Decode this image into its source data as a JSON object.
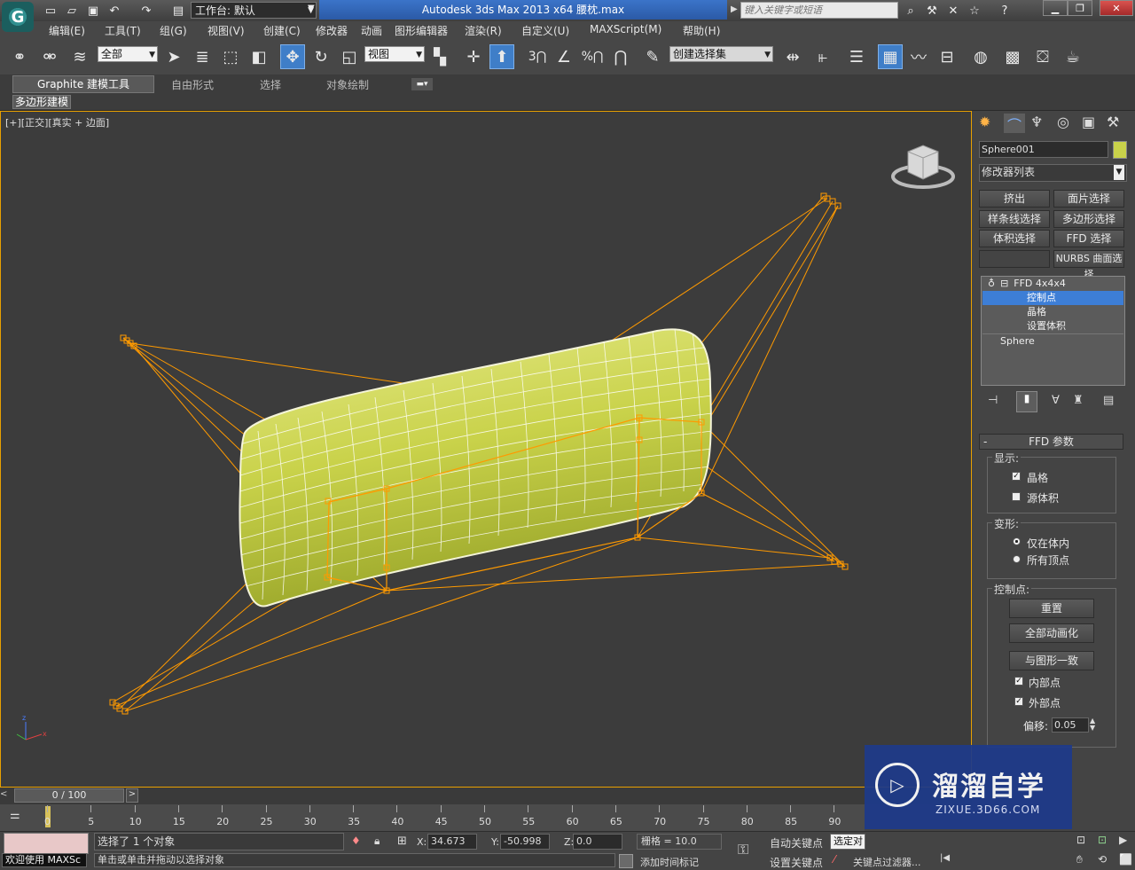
{
  "titlebar": {
    "workspace_label": "工作台: 默认",
    "title": "Autodesk 3ds Max  2013 x64        腰枕.max",
    "search_placeholder": "键入关键字或短语",
    "app_logo": "G"
  },
  "menu": [
    "编辑(E)",
    "工具(T)",
    "组(G)",
    "视图(V)",
    "创建(C)",
    "修改器",
    "动画",
    "图形编辑器",
    "渲染(R)",
    "自定义(U)",
    "MAXScript(M)",
    "帮助(H)"
  ],
  "toolbar": {
    "selection_filter": "全部",
    "ref_coord": "视图",
    "named_selection": "创建选择集"
  },
  "ribbon": {
    "tabs": [
      "Graphite 建模工具",
      "自由形式",
      "选择",
      "对象绘制"
    ],
    "sub_label": "多边形建模"
  },
  "viewport": {
    "label": "[+][正交][真实 + 边面]",
    "object_color": "#c9d24a",
    "lattice_color": "#ff9a00"
  },
  "panel": {
    "object_name": "Sphere001",
    "modifier_list": "修改器列表",
    "buttons": [
      "挤出",
      "面片选择",
      "样条线选择",
      "多边形选择",
      "体积选择",
      "FFD 选择",
      "",
      "NURBS 曲面选择"
    ],
    "stack": {
      "modifier": "FFD 4x4x4",
      "sub_items": [
        "控制点",
        "晶格",
        "设置体积"
      ],
      "base": "Sphere"
    },
    "rollout_title": "FFD 参数",
    "display_group": "显示:",
    "display_opts": [
      {
        "label": "晶格",
        "checked": true
      },
      {
        "label": "源体积",
        "checked": false
      }
    ],
    "deform_group": "变形:",
    "deform_opts": [
      {
        "label": "仅在体内",
        "selected": true
      },
      {
        "label": "所有顶点",
        "selected": false
      }
    ],
    "cp_group": "控制点:",
    "cp_buttons": [
      "重置",
      "全部动画化",
      "与图形一致"
    ],
    "inner_pts": "内部点",
    "outer_pts": "外部点",
    "offset_label": "偏移:",
    "offset_value": "0.05"
  },
  "timeline": {
    "frame": "0 / 100",
    "ticks": [
      "0",
      "5",
      "10",
      "15",
      "20",
      "25",
      "30",
      "35",
      "40",
      "45",
      "50",
      "55",
      "60",
      "65",
      "70",
      "75",
      "80",
      "85",
      "90"
    ]
  },
  "status": {
    "welcome": "欢迎使用 MAXSc",
    "selected": "选择了 1 个对象",
    "prompt": "单击或单击并拖动以选择对象",
    "x_label": "X:",
    "x": "34.673",
    "y_label": "Y:",
    "y": "-50.998",
    "z_label": "Z:",
    "z": "0.0",
    "grid": "栅格 = 10.0",
    "auto_key": "自动关键点",
    "selected_obj": "选定对",
    "set_key": "设置关键点",
    "key_filter": "关键点过滤器...",
    "add_tag": "添加时间标记"
  },
  "watermark": {
    "name": "溜溜自学",
    "url": "ZIXUE.3D66.COM"
  }
}
